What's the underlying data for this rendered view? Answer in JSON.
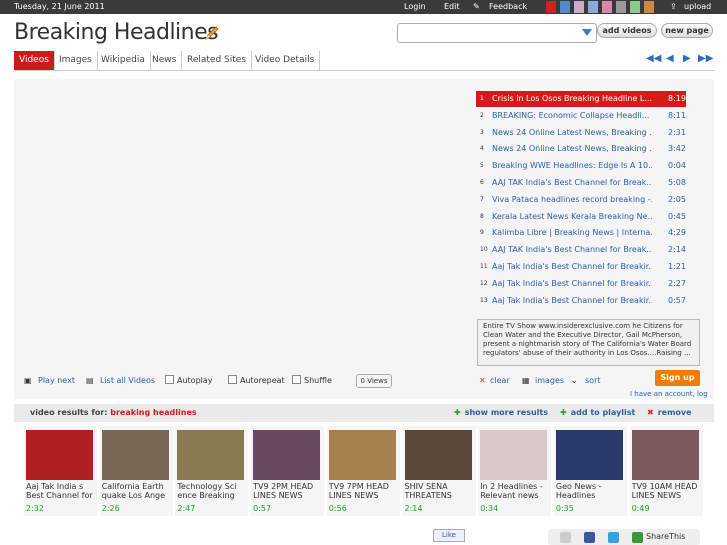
{
  "topbar": {
    "date": "Tuesday, 21 June 2011",
    "login": "Login",
    "edit": "Edit",
    "feedback": "Feedback",
    "upload": "upload",
    "swatches": [
      "#cc2222",
      "#5588cc",
      "#ccaacc",
      "#88aadd",
      "#dd88aa",
      "#999999",
      "#88cc88",
      "#cc8844"
    ]
  },
  "header": {
    "title": "Breaking Headlines",
    "search_value": "",
    "add_videos": "add videos",
    "new_page": "new page"
  },
  "tabs": [
    "Videos",
    "Images",
    "Wikipedia",
    "News",
    "Related Sites",
    "Video Details"
  ],
  "playlist": [
    {
      "n": "1",
      "title": "Crisis in Los Osos Breaking Headline L...",
      "dur": "8:19",
      "active": true
    },
    {
      "n": "2",
      "title": "BREAKING: Economic Collapse Headli...",
      "dur": "8:11"
    },
    {
      "n": "3",
      "title": "News 24 Online Latest News, Breaking ...",
      "dur": "2:31"
    },
    {
      "n": "4",
      "title": "News 24 Online Latest News, Breaking ...",
      "dur": "3:42"
    },
    {
      "n": "5",
      "title": "Breaking WWE Headlines: Edge Is A 10...",
      "dur": "0:04"
    },
    {
      "n": "6",
      "title": "AAJ TAK India's Best Channel for Break...",
      "dur": "5:08"
    },
    {
      "n": "7",
      "title": "Viva Pataca headlines record breaking -...",
      "dur": "2:05"
    },
    {
      "n": "8",
      "title": "Kerala Latest News Kerala Breaking Ne...",
      "dur": "0:45"
    },
    {
      "n": "9",
      "title": "Kalimba Libre | Breaking News | Interna...",
      "dur": "4:29"
    },
    {
      "n": "10",
      "title": "AAJ TAK India's Best Channel for Break...",
      "dur": "2:14"
    },
    {
      "n": "11",
      "title": "Aaj Tak India's Best Channel for Breakir...",
      "dur": "1:21"
    },
    {
      "n": "12",
      "title": "Aaj Tak India's Best Channel for Breakir...",
      "dur": "2:27"
    },
    {
      "n": "13",
      "title": "Aaj Tak India's Best Channel for Breakir...",
      "dur": "0:57"
    }
  ],
  "description": "Entire TV Show www.insiderexclusive.com he Citizens for Clean Water and the Executive Director, Gail McPherson, present a nightmarish story of The California's Water Board regulators' abuse of their authority in Los Osos....Raising ...",
  "controls": {
    "play_next": "Play next",
    "list_all": "List all Videos",
    "autoplay": "Autoplay",
    "autorepeat": "Autorepeat",
    "shuffle": "Shuffle",
    "views": "0 Views",
    "clear": "clear",
    "images": "images",
    "sort": "sort",
    "signup": "Sign up",
    "account": "I have an account, log"
  },
  "results": {
    "label": "video results for:",
    "query": "breaking headlines",
    "show_more": "show more results",
    "add_playlist": "add to playlist",
    "remove": "remove"
  },
  "thumbs": [
    {
      "title": "Aaj Tak India s Best Channel for",
      "dur": "2:32",
      "color": "#b02020"
    },
    {
      "title": "California Earth quake Los Ange",
      "dur": "2:26",
      "color": "#7a6a55"
    },
    {
      "title": "Technology Sci ence Breaking",
      "dur": "2:47",
      "color": "#8a7a50"
    },
    {
      "title": "TV9 2PM HEAD LINES NEWS",
      "dur": "0:57",
      "color": "#6a4a60"
    },
    {
      "title": "TV9 7PM HEAD LINES NEWS",
      "dur": "0:56",
      "color": "#a88050"
    },
    {
      "title": "SHIV SENA THREATENS",
      "dur": "2:14",
      "color": "#5a4a3a"
    },
    {
      "title": "In 2 Headlines - Relevant news",
      "dur": "0:34",
      "color": "#d8c8c8"
    },
    {
      "title": "Geo News - Headlines",
      "dur": "0:35",
      "color": "#2a3a6a"
    },
    {
      "title": "TV9 10AM HEAD LINES NEWS",
      "dur": "0:49",
      "color": "#7a5a5a"
    }
  ],
  "footer": {
    "like": "Like",
    "share": "ShareThis"
  }
}
